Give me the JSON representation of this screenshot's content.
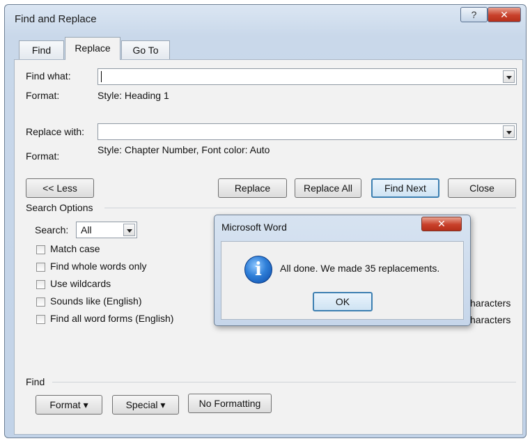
{
  "window": {
    "title": "Find and Replace",
    "help_icon": "?",
    "close_icon": "✕"
  },
  "tabs": [
    {
      "label": "Find",
      "active": false
    },
    {
      "label": "Replace",
      "active": true
    },
    {
      "label": "Go To",
      "active": false
    }
  ],
  "find": {
    "label": "Find what:",
    "value": "",
    "format_label": "Format:",
    "format_value": "Style: Heading 1"
  },
  "replace": {
    "label": "Replace with:",
    "value": "",
    "format_label": "Format:",
    "format_value": "Style: Chapter Number, Font color: Auto"
  },
  "buttons": {
    "less": "<< Less",
    "replace": "Replace",
    "replace_all": "Replace All",
    "find_next": "Find Next",
    "close": "Close"
  },
  "search_options": {
    "title": "Search Options",
    "search_label": "Search:",
    "search_value": "All",
    "checkboxes": [
      {
        "label": "Match case",
        "checked": false
      },
      {
        "label": "Find whole words only",
        "checked": false
      },
      {
        "label": "Use wildcards",
        "checked": false
      },
      {
        "label": "Sounds like (English)",
        "checked": false
      },
      {
        "label": "Find all word forms (English)",
        "checked": false
      }
    ],
    "right_partial": [
      "haracters",
      "haracters"
    ]
  },
  "find_section": {
    "title": "Find",
    "format_btn": "Format ▾",
    "special_btn": "Special ▾",
    "no_formatting_btn": "No Formatting"
  },
  "message_box": {
    "title": "Microsoft Word",
    "close_icon": "✕",
    "icon": "i",
    "message": "All done. We made 35 replacements.",
    "ok": "OK"
  }
}
